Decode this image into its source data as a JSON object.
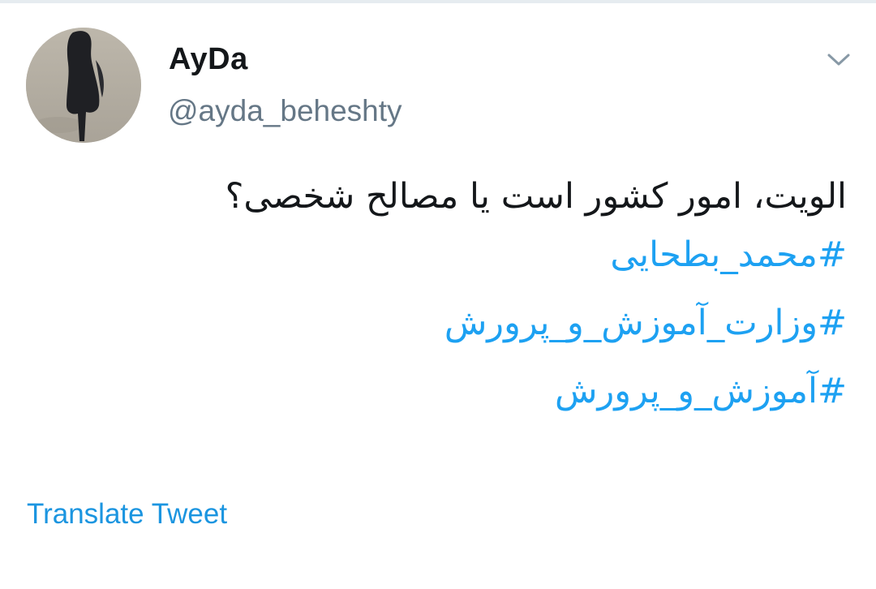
{
  "tweet": {
    "author": {
      "display_name": "AyDa",
      "handle": "@ayda_beheshty"
    },
    "text": "الویت، امور کشور است یا مصالح شخصی؟",
    "hashtags": [
      "#محمد_بطحایی",
      "#وزارت_آموزش_و_پرورش",
      "#آموزش_و_پرورش"
    ],
    "translate_label": "Translate Tweet",
    "menu_icon": "chevron-down-icon"
  },
  "colors": {
    "link": "#1da1f2",
    "handle": "#657786",
    "text": "#14171a"
  }
}
